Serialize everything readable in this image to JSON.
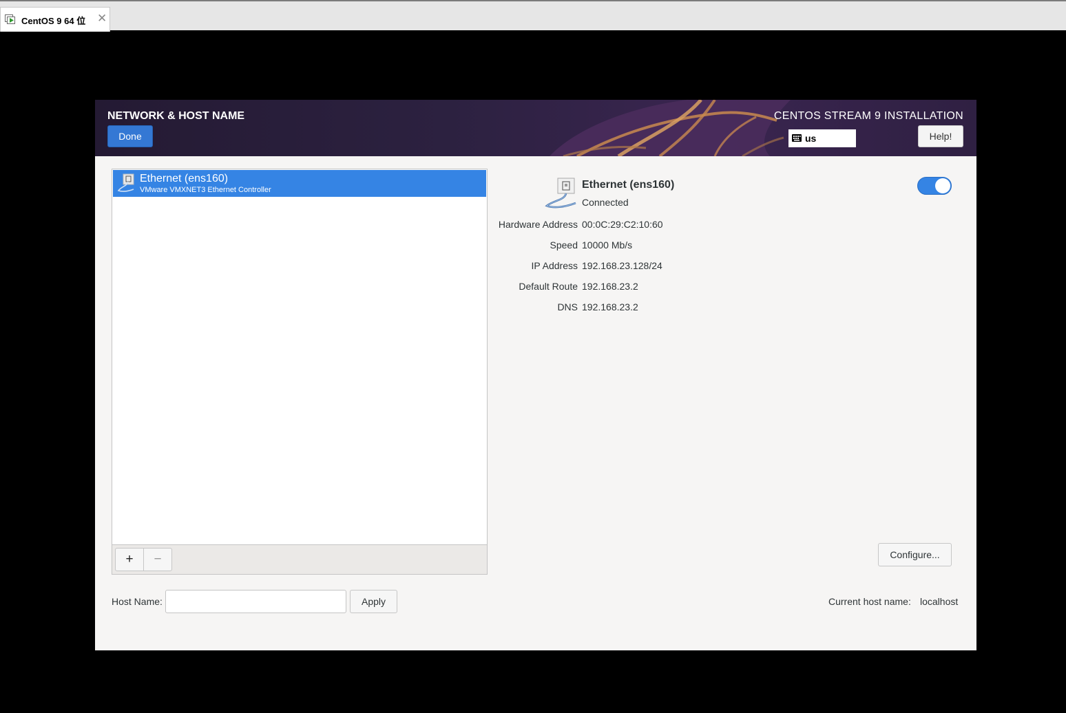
{
  "vm_tab": {
    "label": "CentOS 9 64 位",
    "icon": "vm-play-icon"
  },
  "header": {
    "spoke_title": "NETWORK & HOST NAME",
    "done_label": "Done",
    "product_title": "CENTOS STREAM 9 INSTALLATION",
    "keyboard_layout": "us",
    "help_label": "Help!"
  },
  "devices": [
    {
      "name": "Ethernet (ens160)",
      "description": "VMware VMXNET3 Ethernet Controller",
      "selected": true,
      "icon": "wired-network-icon"
    }
  ],
  "list_toolbar": {
    "add_label": "+",
    "remove_label": "−"
  },
  "detail": {
    "name": "Ethernet (ens160)",
    "status": "Connected",
    "enabled": true,
    "rows": [
      {
        "label": "Hardware Address",
        "value": "00:0C:29:C2:10:60"
      },
      {
        "label": "Speed",
        "value": "10000 Mb/s"
      },
      {
        "label": "IP Address",
        "value": "192.168.23.128/24"
      },
      {
        "label": "Default Route",
        "value": "192.168.23.2"
      },
      {
        "label": "DNS",
        "value": "192.168.23.2"
      }
    ],
    "configure_label": "Configure..."
  },
  "hostname": {
    "label": "Host Name:",
    "value": "",
    "apply_label": "Apply",
    "current_label": "Current host name:",
    "current_value": "localhost"
  },
  "colors": {
    "accent": "#3584e4",
    "header_bg": "#2c2140",
    "panel_bg": "#f6f5f4"
  }
}
